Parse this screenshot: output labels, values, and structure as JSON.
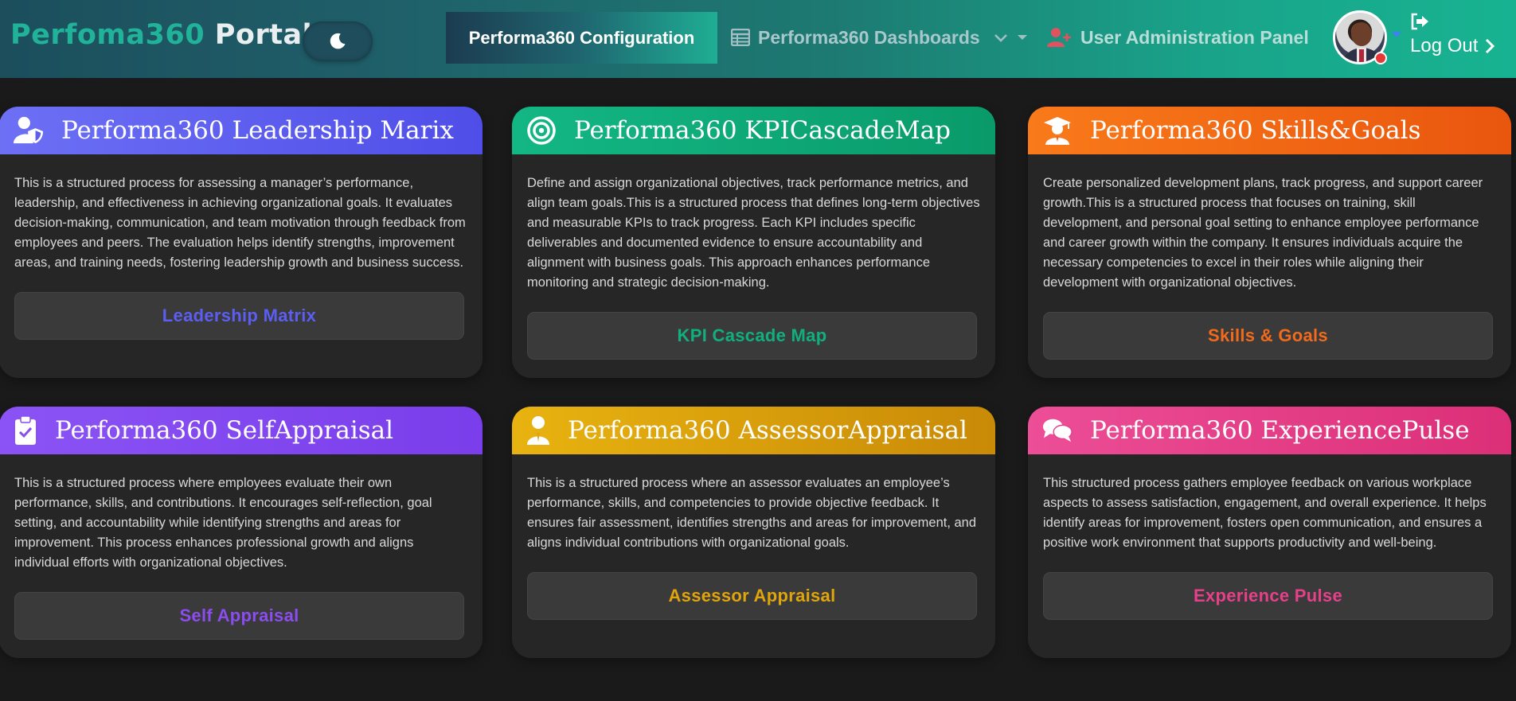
{
  "colors": {
    "leadership": "#5b5ef0",
    "kpi": "#10b07e",
    "skills": "#f26a1b",
    "self": "#8b4cf0",
    "assessor": "#e0a50c",
    "experience": "#e6408a"
  },
  "navbar": {
    "brand_part1": "Perfoma360",
    "brand_part2": "Portal",
    "theme_icon": "moon-icon",
    "config_label": "Performa360 Configuration",
    "dashboards_label": "Performa360 Dashboards",
    "dashboards_icon": "table-icon",
    "admin_label": "User Administration Panel",
    "admin_icon": "user-plus-icon",
    "logout_label": "Log Out",
    "logout_icon": "sign-out-icon"
  },
  "cards": [
    {
      "title": "Performa360 Leadership Marix",
      "icon": "user-shield-icon",
      "text": "This is a structured process for assessing a manager’s performance, leadership, and effectiveness in achieving organizational goals. It evaluates decision-making, communication, and team motivation through feedback from employees and peers. The evaluation helps identify strengths, improvement areas, and training needs, fostering leadership growth and business success.",
      "button": "Leadership Matrix"
    },
    {
      "title": "Performa360 KPICascadeMap",
      "icon": "target-icon",
      "text": "Define and assign organizational objectives, track performance metrics, and align team goals.This is a structured process that defines long-term objectives and measurable KPIs to track progress. Each KPI includes specific deliverables and documented evidence to ensure accountability and alignment with business goals. This approach enhances performance monitoring and strategic decision-making.",
      "button": "KPI Cascade Map"
    },
    {
      "title": "Performa360 Skills&Goals",
      "icon": "graduate-icon",
      "text": "Create personalized development plans, track progress, and support career growth.This is a structured process that focuses on training, skill development, and personal goal setting to enhance employee performance and career growth within the company. It ensures individuals acquire the necessary competencies to excel in their roles while aligning their development with organizational objectives.",
      "button": "Skills & Goals"
    },
    {
      "title": "Performa360 SelfAppraisal",
      "icon": "clipboard-check-icon",
      "text": "This is a structured process where employees evaluate their own performance, skills, and contributions. It encourages self-reflection, goal setting, and accountability while identifying strengths and areas for improvement. This process enhances professional growth and aligns individual efforts with organizational objectives.",
      "button": "Self Appraisal"
    },
    {
      "title": "Performa360 AssessorAppraisal",
      "icon": "user-tie-icon",
      "text": "This is a structured process where an assessor evaluates an employee’s performance, skills, and competencies to provide objective feedback. It ensures fair assessment, identifies strengths and areas for improvement, and aligns individual contributions with organizational goals.",
      "button": "Assessor Appraisal"
    },
    {
      "title": "Performa360 ExperiencePulse",
      "icon": "comments-icon",
      "text": "This structured process gathers employee feedback on various workplace aspects to assess satisfaction, engagement, and overall experience. It helps identify areas for improvement, fosters open communication, and ensures a positive work environment that supports productivity and well-being.",
      "button": "Experience Pulse"
    }
  ]
}
